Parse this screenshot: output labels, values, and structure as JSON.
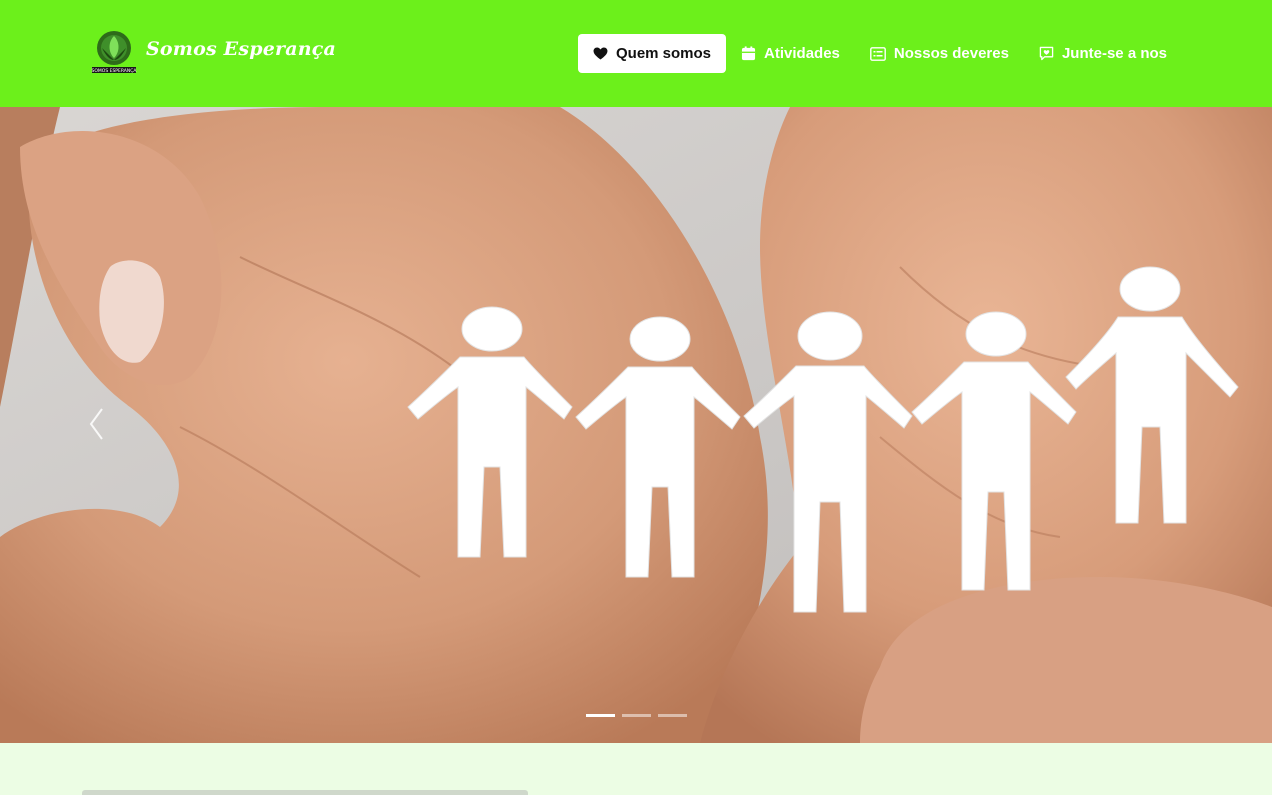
{
  "brand": {
    "name": "Somos Esperança",
    "logo_icon": "somos-esperanca-emblem-icon",
    "logo_caption": "SOMOS ESPERANÇA"
  },
  "nav": {
    "items": [
      {
        "label": "Quem somos",
        "icon": "heart-icon",
        "active": true
      },
      {
        "label": "Atividades",
        "icon": "calendar-icon",
        "active": false
      },
      {
        "label": "Nossos deveres",
        "icon": "list-card-icon",
        "active": false
      },
      {
        "label": "Junte-se a nos",
        "icon": "chat-heart-icon",
        "active": false
      }
    ]
  },
  "carousel": {
    "slide_count": 3,
    "active_slide": 1,
    "prev_icon": "chevron-left-icon",
    "next_icon": "chevron-right-icon"
  },
  "colors": {
    "navbar": "#6cf01b",
    "page_background": "#ecfde4",
    "active_nav_background": "#ffffff"
  }
}
